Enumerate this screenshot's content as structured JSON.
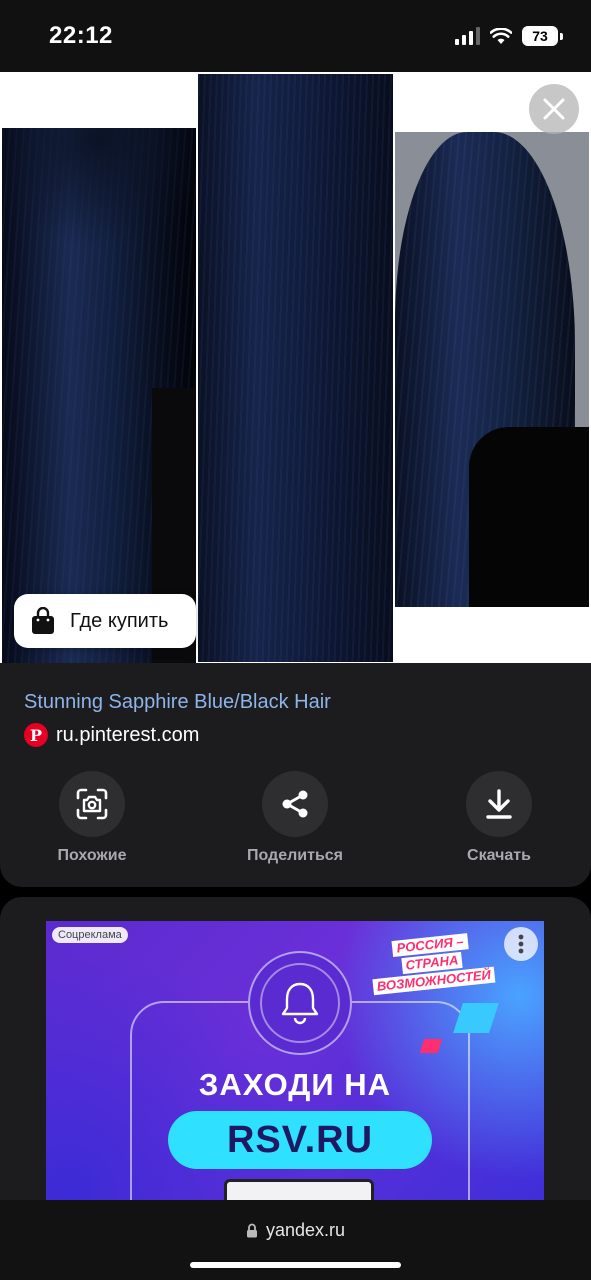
{
  "status_bar": {
    "time": "22:12",
    "battery": "73"
  },
  "image_viewer": {
    "buy_button_label": "Где купить"
  },
  "result": {
    "title": "Stunning Sapphire Blue/Black Hair",
    "source": "ru.pinterest.com",
    "source_icon": "P"
  },
  "actions": [
    {
      "label": "Похожие",
      "icon": "camera-search-icon"
    },
    {
      "label": "Поделиться",
      "icon": "share-icon"
    },
    {
      "label": "Скачать",
      "icon": "download-icon"
    }
  ],
  "ad": {
    "badge": "Соцреклама",
    "slogan": [
      "РОССИЯ –",
      "СТРАНА",
      "ВОЗМОЖНОСТЕЙ"
    ],
    "headline": "ЗАХОДИ НА",
    "site": "RSV.RU"
  },
  "browser": {
    "url": "yandex.ru"
  },
  "colors": {
    "link": "#8fb4e8",
    "pinterest": "#e60023",
    "ad_accent": "#2fe0ff"
  }
}
